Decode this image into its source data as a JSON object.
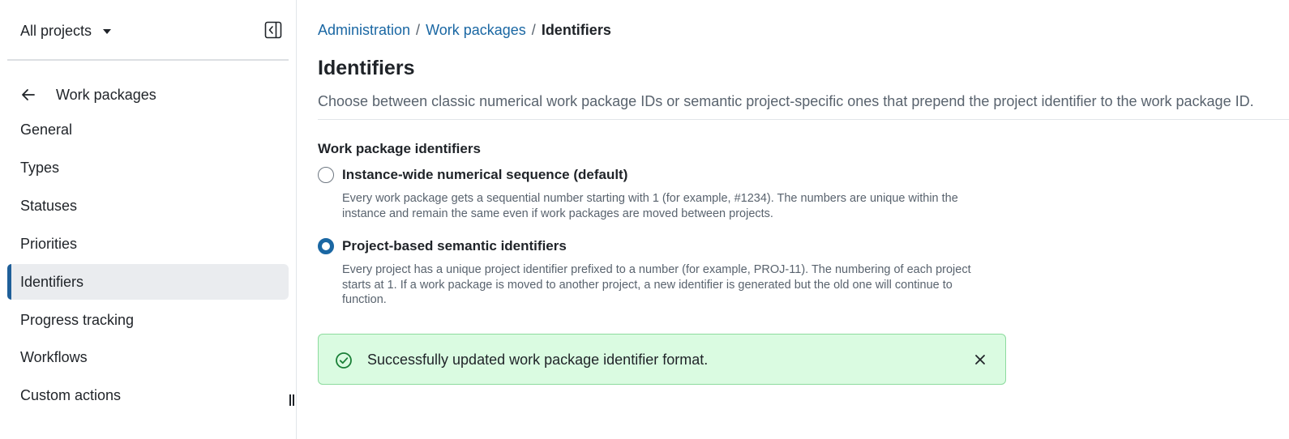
{
  "sidebar": {
    "project_selector": "All projects",
    "back_label": "Work packages",
    "items": [
      {
        "label": "General",
        "active": false
      },
      {
        "label": "Types",
        "active": false
      },
      {
        "label": "Statuses",
        "active": false
      },
      {
        "label": "Priorities",
        "active": false
      },
      {
        "label": "Identifiers",
        "active": true
      },
      {
        "label": "Progress tracking",
        "active": false
      },
      {
        "label": "Workflows",
        "active": false
      },
      {
        "label": "Custom actions",
        "active": false
      }
    ]
  },
  "breadcrumb": {
    "items": [
      "Administration",
      "Work packages"
    ],
    "current": "Identifiers",
    "separator": "/"
  },
  "page": {
    "title": "Identifiers",
    "description": "Choose between classic numerical work package IDs or semantic project-specific ones that prepend the project identifier to the work package ID."
  },
  "form": {
    "section_label": "Work package identifiers",
    "options": [
      {
        "label": "Instance-wide numerical sequence (default)",
        "caption": "Every work package gets a sequential number starting with 1 (for example, #1234). The numbers are unique within the instance and remain the same even if work packages are moved between projects.",
        "checked": false
      },
      {
        "label": "Project-based semantic identifiers",
        "caption": "Every project has a unique project identifier prefixed to a number (for example, PROJ-11). The numbering of each project starts at 1. If a work package is moved to another project, a new identifier is generated but the old one will continue to function.",
        "checked": true
      }
    ]
  },
  "flash": {
    "message": "Successfully updated work package identifier format.",
    "icon": "check-circle-icon",
    "close_icon": "close-icon"
  },
  "colors": {
    "accent": "#1a67a3",
    "flash_bg": "#dafbe1",
    "flash_border": "#8ddb9e",
    "active_nav_bg": "#eaecef"
  }
}
